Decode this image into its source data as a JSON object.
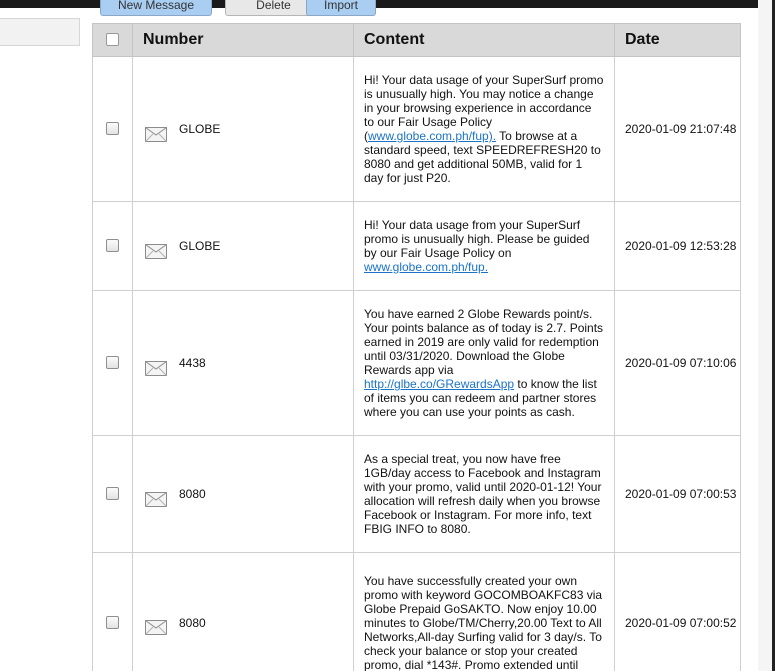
{
  "toolbar": {
    "new_message": "New Message",
    "delete": "Delete",
    "import": "Import"
  },
  "table": {
    "headers": {
      "number": "Number",
      "content": "Content",
      "date": "Date"
    },
    "rows": [
      {
        "number": "GLOBE",
        "content_before": "Hi! Your data usage of your SuperSurf promo is unusually high. You may notice a change in your browsing experience in accordance to our Fair Usage Policy (",
        "content_link": "www.globe.com.ph/fup).",
        "content_after": " To browse at a standard speed, text SPEEDREFRESH20 to 8080 and get additional 50MB, valid for 1 day for just P20.",
        "date": "2020-01-09 21:07:48"
      },
      {
        "number": "GLOBE",
        "content_before": "Hi! Your data usage from your SuperSurf promo is unusually high. Please be guided by our Fair Usage Policy on ",
        "content_link": "www.globe.com.ph/fup.",
        "content_after": "",
        "date": "2020-01-09 12:53:28"
      },
      {
        "number": "4438",
        "content_before": "You have earned 2 Globe Rewards point/s. Your points balance as of today is 2.7. Points earned in 2019 are only valid for redemption until 03/31/2020. Download the Globe Rewards app via ",
        "content_link": "http://glbe.co/GRewardsApp",
        "content_after": " to know the list of items you can redeem and partner stores where you can use your points as cash.",
        "date": "2020-01-09 07:10:06"
      },
      {
        "number": "8080",
        "content_before": "As a special treat, you now have free 1GB/day access to Facebook and Instagram with your promo, valid until 2020-01-12! Your allocation will refresh daily when you browse Facebook or Instagram. For more info, text FBIG INFO to 8080.",
        "content_link": "",
        "content_after": "",
        "date": "2020-01-09 07:00:53"
      },
      {
        "number": "8080",
        "content_before": "You have successfully created your own promo with keyword GOCOMBOAKFC83 via Globe Prepaid GoSAKTO. Now enjoy 10.00 minutes to Globe/TM/Cherry,20.00 Text to All Networks,All-day Surfing valid for 3 day/s. To check your balance or stop your created promo, dial *143#. Promo extended until",
        "content_link": "",
        "content_after": "",
        "date": "2020-01-09 07:00:52"
      }
    ]
  }
}
